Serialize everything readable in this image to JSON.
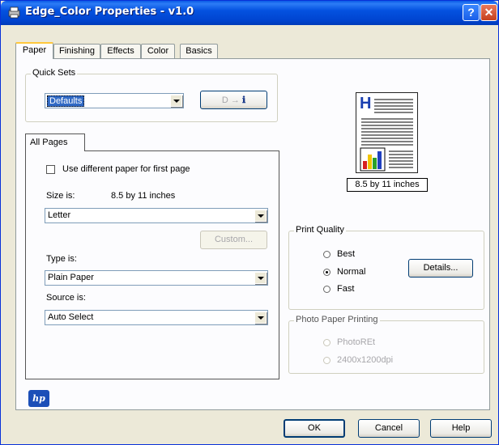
{
  "window": {
    "title": "Edge_Color Properties - v1.0"
  },
  "tabs": [
    {
      "label": "Paper",
      "active": true
    },
    {
      "label": "Finishing"
    },
    {
      "label": "Effects"
    },
    {
      "label": "Color"
    },
    {
      "label": "Basics"
    }
  ],
  "quick_sets": {
    "legend": "Quick Sets",
    "value": "Defaults",
    "icon_button_label": "D",
    "icon": "info-icon"
  },
  "all_pages": {
    "tab_label": "All Pages",
    "use_different_paper_label": "Use different paper for first page",
    "size_label": "Size is:",
    "size_value": "8.5 by 11 inches",
    "size_select": "Letter",
    "custom_button": "Custom...",
    "type_label": "Type is:",
    "type_select": "Plain Paper",
    "source_label": "Source is:",
    "source_select": "Auto Select"
  },
  "preview": {
    "caption": "8.5 by 11 inches",
    "letter": "H"
  },
  "print_quality": {
    "legend": "Print Quality",
    "options": [
      "Best",
      "Normal",
      "Fast"
    ],
    "selected": "Normal",
    "details_button": "Details..."
  },
  "photo_paper": {
    "legend": "Photo Paper Printing",
    "options": [
      "PhotoREt",
      "2400x1200dpi"
    ]
  },
  "logo": {
    "text": "hp"
  },
  "footer": {
    "ok": "OK",
    "cancel": "Cancel",
    "help": "Help"
  },
  "colors": {
    "titlebar": "#0452e0",
    "dialog_bg": "#ece9d8",
    "selection": "#316ac5"
  }
}
